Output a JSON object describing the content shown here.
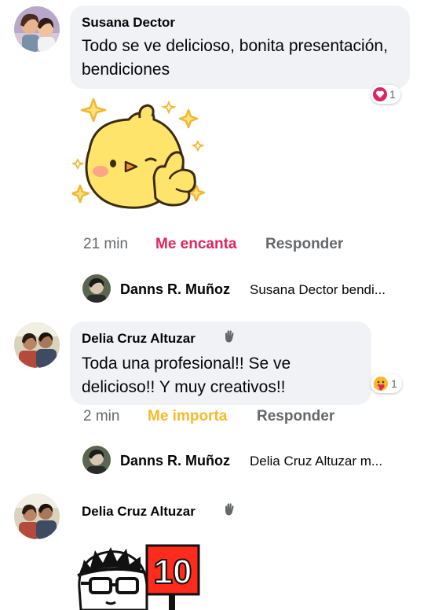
{
  "comments": [
    {
      "author": "Susana Dector",
      "text": "Todo se ve delicioso, bonita presentación, bendiciones",
      "reaction_count": "1",
      "reaction_icon": "love-heart-icon",
      "time": "21 min",
      "reaction_label": "Me encanta",
      "reaction_color": "#e0245e",
      "reply_label": "Responder",
      "reply_preview": {
        "author": "Danns R. Muñoz",
        "text": "Susana Dector bendi..."
      }
    },
    {
      "author": "Delia Cruz Altuzar",
      "text": "Toda una profesional!! Se ve delicioso!! Y muy creativos!!",
      "reaction_count": "1",
      "reaction_icon": "care-hug-icon",
      "time": "2 min",
      "reaction_label": "Me importa",
      "reaction_color": "#f7b928",
      "reply_label": "Responder",
      "reply_preview": {
        "author": "Danns R. Muñoz",
        "text": "Delia Cruz Altuzar m..."
      }
    },
    {
      "author": "Delia Cruz Altuzar"
    }
  ],
  "sticker_10_label": "10"
}
